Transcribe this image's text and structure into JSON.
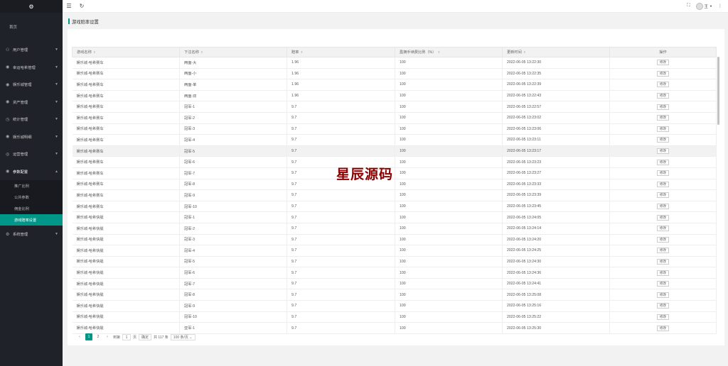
{
  "sidebar": {
    "home": "首页",
    "menu": [
      {
        "icon": "user-icon",
        "glyph": "⚇",
        "label": "用户管理"
      },
      {
        "icon": "game-icon",
        "glyph": "◉",
        "label": "幸运哈希管理"
      },
      {
        "icon": "casino-icon",
        "glyph": "◉",
        "label": "娱乐城管理"
      },
      {
        "icon": "asset-icon",
        "glyph": "◉",
        "label": "资产管理"
      },
      {
        "icon": "stats-icon",
        "glyph": "◷",
        "label": "统计管理"
      },
      {
        "icon": "casino-detail-icon",
        "glyph": "◉",
        "label": "娱乐城明细"
      },
      {
        "icon": "ops-icon",
        "glyph": "◎",
        "label": "运营管理"
      },
      {
        "icon": "params-icon",
        "glyph": "◉",
        "label": "参数配置"
      }
    ],
    "submenu": [
      "推广比例",
      "公共参数",
      "佣金比例",
      "游戏赔率设置"
    ],
    "system": {
      "icon": "system-icon",
      "glyph": "⚙",
      "label": "系统管理"
    }
  },
  "header": {
    "user": "王",
    "menu_glyph": "☰",
    "refresh_glyph": "↻",
    "fullscreen_glyph": "⛶",
    "more_glyph": "⋮"
  },
  "page_title": "游戏赔率设置",
  "table": {
    "columns": [
      "游戏名称",
      "下注名称",
      "赔率",
      "盈拥手续费比例（%）",
      "更新时间",
      "操作"
    ],
    "edit_label": "修改",
    "rows": [
      [
        "娱乐城-哈希赛车",
        "两面-大",
        "1.96",
        "100",
        "2022-06-05 13:22:30"
      ],
      [
        "娱乐城-哈希赛车",
        "两面-小",
        "1.96",
        "100",
        "2022-06-05 13:22:35"
      ],
      [
        "娱乐城-哈希赛车",
        "两面-单",
        "1.96",
        "100",
        "2022-06-05 13:22:39"
      ],
      [
        "娱乐城-哈希赛车",
        "两面-双",
        "1.96",
        "100",
        "2022-06-05 13:22:43"
      ],
      [
        "娱乐城-哈希赛车",
        "冠军-1",
        "9.7",
        "100",
        "2022-06-05 13:22:57"
      ],
      [
        "娱乐城-哈希赛车",
        "冠军-2",
        "9.7",
        "100",
        "2022-06-05 13:23:02"
      ],
      [
        "娱乐城-哈希赛车",
        "冠军-3",
        "9.7",
        "100",
        "2022-06-05 13:23:06"
      ],
      [
        "娱乐城-哈希赛车",
        "冠军-4",
        "9.7",
        "100",
        "2022-06-05 13:23:11"
      ],
      [
        "娱乐城-哈希赛车",
        "冠军-5",
        "9.7",
        "100",
        "2022-06-05 13:23:17"
      ],
      [
        "娱乐城-哈希赛车",
        "冠军-6",
        "9.7",
        "100",
        "2022-06-05 13:23:23"
      ],
      [
        "娱乐城-哈希赛车",
        "冠军-7",
        "9.7",
        "100",
        "2022-06-05 13:23:27"
      ],
      [
        "娱乐城-哈希赛车",
        "冠军-8",
        "9.7",
        "100",
        "2022-06-05 13:23:33"
      ],
      [
        "娱乐城-哈希赛车",
        "冠军-9",
        "9.7",
        "100",
        "2022-06-05 13:23:39"
      ],
      [
        "娱乐城-哈希赛车",
        "冠军-10",
        "9.7",
        "100",
        "2022-06-05 13:23:45"
      ],
      [
        "娱乐城-哈希快艇",
        "冠军-1",
        "9.7",
        "100",
        "2022-06-05 13:24:05"
      ],
      [
        "娱乐城-哈希快艇",
        "冠军-2",
        "9.7",
        "100",
        "2022-06-05 13:24:14"
      ],
      [
        "娱乐城-哈希快艇",
        "冠军-3",
        "9.7",
        "100",
        "2022-06-05 13:24:20"
      ],
      [
        "娱乐城-哈希快艇",
        "冠军-4",
        "9.7",
        "100",
        "2022-06-05 13:24:25"
      ],
      [
        "娱乐城-哈希快艇",
        "冠军-5",
        "9.7",
        "100",
        "2022-06-05 13:24:30"
      ],
      [
        "娱乐城-哈希快艇",
        "冠军-6",
        "9.7",
        "100",
        "2022-06-05 13:24:36"
      ],
      [
        "娱乐城-哈希快艇",
        "冠军-7",
        "9.7",
        "100",
        "2022-06-05 13:24:41"
      ],
      [
        "娱乐城-哈希快艇",
        "冠军-8",
        "9.7",
        "100",
        "2022-06-05 13:25:08"
      ],
      [
        "娱乐城-哈希快艇",
        "冠军-9",
        "9.7",
        "100",
        "2022-06-05 13:25:16"
      ],
      [
        "娱乐城-哈希快艇",
        "冠军-10",
        "9.7",
        "100",
        "2022-06-05 13:25:22"
      ],
      [
        "娱乐城-哈希快艇",
        "亚军-1",
        "9.7",
        "100",
        "2022-06-05 13:25:30"
      ]
    ]
  },
  "pager": {
    "prev": "‹",
    "pages": [
      "1",
      "2"
    ],
    "next": "›",
    "goto_label": "到第",
    "goto_value": "1",
    "page_unit": "页",
    "confirm": "确定",
    "total": "共 117 条",
    "page_size": "100 条/页"
  },
  "watermark": "星辰源码",
  "colors": {
    "accent": "#009688",
    "sidebar": "#20222a"
  }
}
